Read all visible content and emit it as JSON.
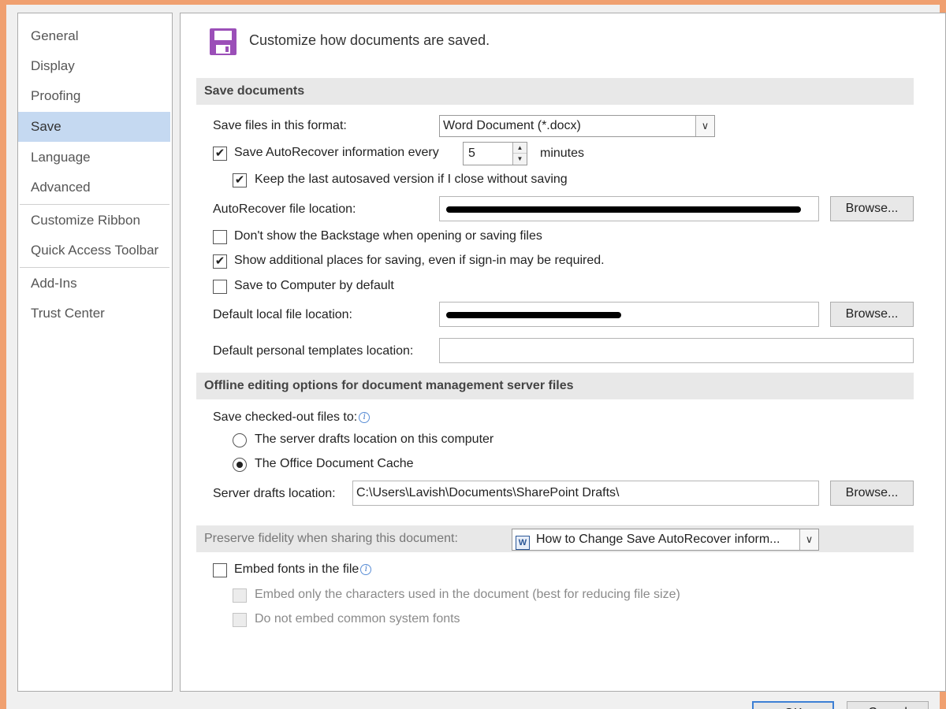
{
  "sidebar": {
    "items": [
      {
        "label": "General"
      },
      {
        "label": "Display"
      },
      {
        "label": "Proofing"
      },
      {
        "label": "Save"
      },
      {
        "label": "Language"
      },
      {
        "label": "Advanced"
      },
      {
        "label": "Customize Ribbon"
      },
      {
        "label": "Quick Access Toolbar"
      },
      {
        "label": "Add-Ins"
      },
      {
        "label": "Trust Center"
      }
    ],
    "selected": "Save"
  },
  "header": {
    "icon": "floppy-disk-icon",
    "title": "Customize how documents are saved."
  },
  "save_documents": {
    "section_title": "Save documents",
    "format_label": "Save files in this format:",
    "format_value": "Word Document (*.docx)",
    "autorecover_label": "Save AutoRecover information every",
    "autorecover_checked": true,
    "autorecover_minutes": "5",
    "minutes_label": "minutes",
    "keep_last_label": "Keep the last autosaved version if I close without saving",
    "keep_last_checked": true,
    "autorecover_location_label": "AutoRecover file location:",
    "browse_label": "Browse...",
    "dont_show_backstage_label": "Don't show the Backstage when opening or saving files",
    "dont_show_backstage_checked": false,
    "show_additional_label": "Show additional places for saving, even if sign-in may be required.",
    "show_additional_checked": true,
    "save_to_computer_label": "Save to Computer by default",
    "save_to_computer_checked": false,
    "default_local_label": "Default local file location:",
    "default_templates_label": "Default personal templates location:",
    "default_templates_value": ""
  },
  "offline": {
    "section_title": "Offline editing options for document management server files",
    "checked_out_label": "Save checked-out files to:",
    "option_server": "The server drafts location on this computer",
    "option_cache": "The Office Document Cache",
    "selected_option": "cache",
    "server_drafts_label": "Server drafts location:",
    "server_drafts_value": "C:\\Users\\Lavish\\Documents\\SharePoint Drafts\\"
  },
  "fidelity": {
    "section_label": "Preserve fidelity when sharing this document:",
    "document_value": "How to Change Save AutoRecover inform...",
    "embed_fonts_label": "Embed fonts in the file",
    "embed_fonts_checked": false,
    "embed_only_label": "Embed only the characters used in the document (best for reducing file size)",
    "do_not_embed_label": "Do not embed common system fonts"
  },
  "footer": {
    "ok_label": "OK",
    "cancel_label": "Cancel"
  },
  "colors": {
    "selected_nav": "#c5d9f1",
    "window_frame": "#f0a070",
    "save_icon": "#9b4fb8"
  }
}
